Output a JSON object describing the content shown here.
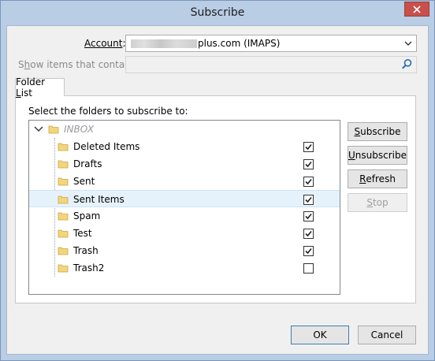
{
  "window": {
    "title": "Subscribe"
  },
  "account": {
    "label_pre": "Account",
    "label_post": ":",
    "value": "plus.com (IMAPS)"
  },
  "show_items": {
    "label_pre": "S",
    "label_u": "h",
    "label_post": "ow items that contain:",
    "value": ""
  },
  "tab": {
    "label_pre": "Folder ",
    "label_u": "L",
    "label_post": "ist"
  },
  "tree": {
    "instruction": "Select the folders to subscribe to:",
    "root": "INBOX",
    "folders": [
      {
        "name": "Deleted Items",
        "checked": true
      },
      {
        "name": "Drafts",
        "checked": true
      },
      {
        "name": "Sent",
        "checked": true
      },
      {
        "name": "Sent Items",
        "checked": true,
        "selected": true
      },
      {
        "name": "Spam",
        "checked": true
      },
      {
        "name": "Test",
        "checked": true
      },
      {
        "name": "Trash",
        "checked": true
      },
      {
        "name": "Trash2",
        "checked": false
      }
    ]
  },
  "buttons": {
    "subscribe": {
      "u": "S",
      "rest": "ubscribe"
    },
    "unsubscribe": {
      "u": "U",
      "rest": "nsubscribe"
    },
    "refresh": {
      "u": "R",
      "rest": "efresh"
    },
    "stop": {
      "u": "S",
      "rest": "top"
    },
    "ok": "OK",
    "cancel": "Cancel"
  },
  "colors": {
    "titlebar": "#b9cde5",
    "close": "#c7504c",
    "selection": "#e6f2fb",
    "folder": "#f3d67a"
  },
  "icons": {
    "close": "close-icon",
    "dropdown": "chevron-down-icon",
    "search": "search-icon",
    "folder": "folder-icon",
    "collapse": "chevron-collapse-icon"
  }
}
